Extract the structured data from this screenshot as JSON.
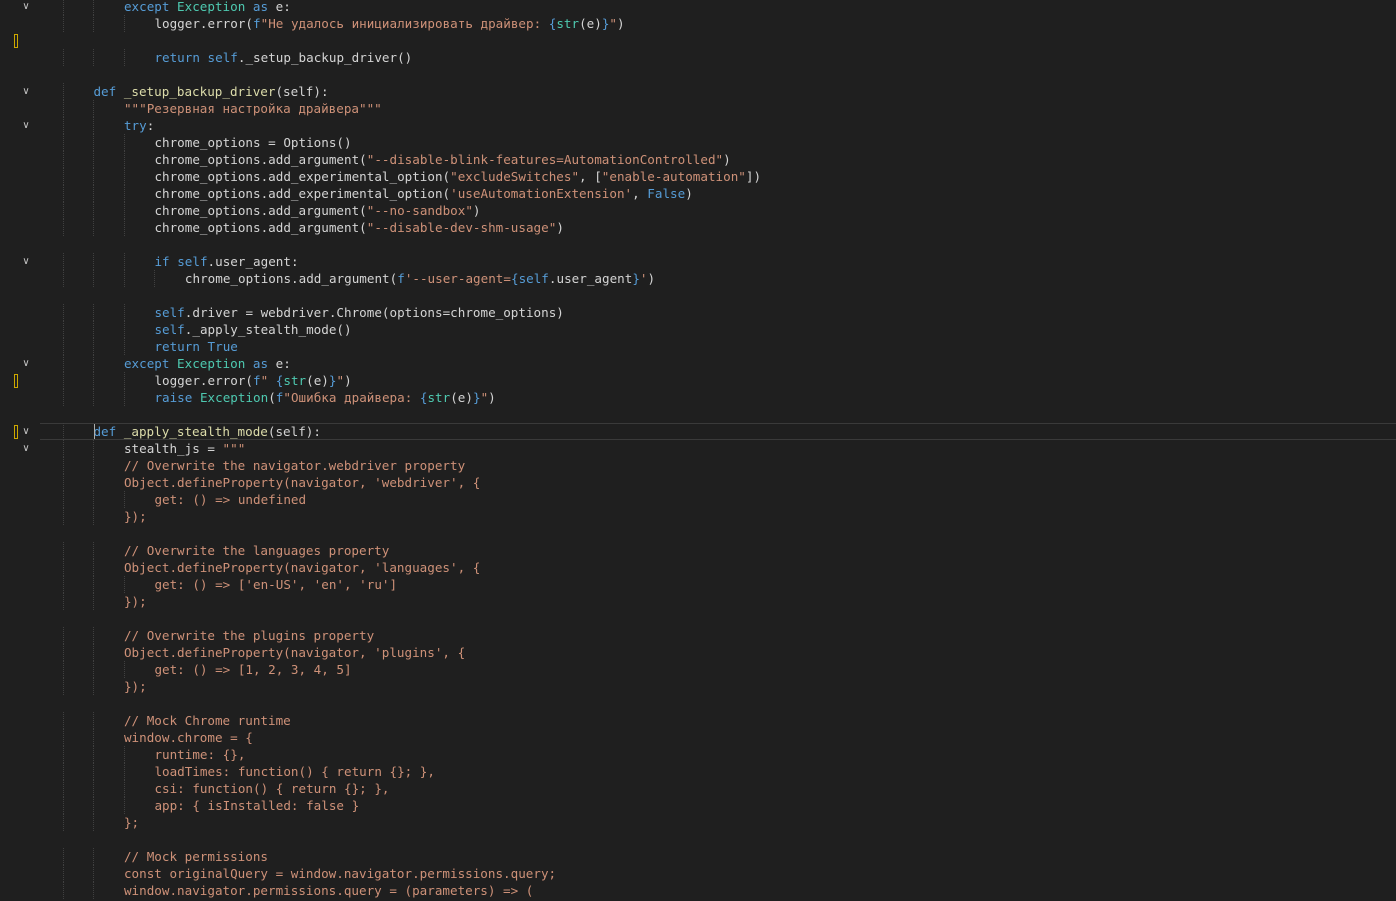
{
  "editor": {
    "language": "python",
    "colors": {
      "background": "#1f1f1f",
      "keyword": "#569cd6",
      "string": "#ce9178",
      "function": "#dcdcaa",
      "class": "#4ec9b0",
      "text": "#d4d4d4"
    },
    "lines": [
      [
        {
          "t": "except",
          "c": "kw"
        },
        {
          "t": " "
        },
        {
          "t": "Exception",
          "c": "cls"
        },
        {
          "t": " "
        },
        {
          "t": "as",
          "c": "kw"
        },
        {
          "t": " e:"
        }
      ],
      [
        {
          "t": "logger.error("
        },
        {
          "t": "f",
          "c": "kw"
        },
        {
          "t": "\"Не удалось инициализировать драйвер: ",
          "c": "str"
        },
        {
          "t": "{",
          "c": "kw"
        },
        {
          "t": "str",
          "c": "bi"
        },
        {
          "t": "(e)"
        },
        {
          "t": "}",
          "c": "kw"
        },
        {
          "t": "\"",
          "c": "str"
        },
        {
          "t": ")"
        }
      ],
      [],
      [
        {
          "t": "return",
          "c": "kw"
        },
        {
          "t": " "
        },
        {
          "t": "self",
          "c": "self"
        },
        {
          "t": "._setup_backup_driver()"
        }
      ],
      [],
      [
        {
          "t": "def",
          "c": "kw"
        },
        {
          "t": " "
        },
        {
          "t": "_setup_backup_driver",
          "c": "fn"
        },
        {
          "t": "(self):"
        }
      ],
      [
        {
          "t": "\"\"\"Резервная настройка драйвера\"\"\"",
          "c": "str"
        }
      ],
      [
        {
          "t": "try",
          "c": "kw"
        },
        {
          "t": ":"
        }
      ],
      [
        {
          "t": "chrome_options = Options()"
        }
      ],
      [
        {
          "t": "chrome_options.add_argument("
        },
        {
          "t": "\"--disable-blink-features=AutomationControlled\"",
          "c": "str"
        },
        {
          "t": ")"
        }
      ],
      [
        {
          "t": "chrome_options.add_experimental_option("
        },
        {
          "t": "\"excludeSwitches\"",
          "c": "str"
        },
        {
          "t": ", ["
        },
        {
          "t": "\"enable-automation\"",
          "c": "str"
        },
        {
          "t": "])"
        }
      ],
      [
        {
          "t": "chrome_options.add_experimental_option("
        },
        {
          "t": "'useAutomationExtension'",
          "c": "str"
        },
        {
          "t": ", "
        },
        {
          "t": "False",
          "c": "kw"
        },
        {
          "t": ")"
        }
      ],
      [
        {
          "t": "chrome_options.add_argument("
        },
        {
          "t": "\"--no-sandbox\"",
          "c": "str"
        },
        {
          "t": ")"
        }
      ],
      [
        {
          "t": "chrome_options.add_argument("
        },
        {
          "t": "\"--disable-dev-shm-usage\"",
          "c": "str"
        },
        {
          "t": ")"
        }
      ],
      [],
      [
        {
          "t": "if",
          "c": "kw"
        },
        {
          "t": " "
        },
        {
          "t": "self",
          "c": "self"
        },
        {
          "t": ".user_agent:"
        }
      ],
      [
        {
          "t": "chrome_options.add_argument("
        },
        {
          "t": "f",
          "c": "kw"
        },
        {
          "t": "'--user-agent=",
          "c": "str"
        },
        {
          "t": "{",
          "c": "kw"
        },
        {
          "t": "self",
          "c": "self"
        },
        {
          "t": ".user_agent"
        },
        {
          "t": "}",
          "c": "kw"
        },
        {
          "t": "'",
          "c": "str"
        },
        {
          "t": ")"
        }
      ],
      [],
      [
        {
          "t": "self",
          "c": "self"
        },
        {
          "t": ".driver = webdriver.Chrome(options=chrome_options)"
        }
      ],
      [
        {
          "t": "self",
          "c": "self"
        },
        {
          "t": "._apply_stealth_mode()"
        }
      ],
      [
        {
          "t": "return",
          "c": "kw"
        },
        {
          "t": " "
        },
        {
          "t": "True",
          "c": "kw"
        }
      ],
      [
        {
          "t": "except",
          "c": "kw"
        },
        {
          "t": " "
        },
        {
          "t": "Exception",
          "c": "cls"
        },
        {
          "t": " "
        },
        {
          "t": "as",
          "c": "kw"
        },
        {
          "t": " e:"
        }
      ],
      [
        {
          "t": "logger.error("
        },
        {
          "t": "f",
          "c": "kw"
        },
        {
          "t": "\" ",
          "c": "str"
        },
        {
          "t": "{",
          "c": "kw"
        },
        {
          "t": "str",
          "c": "bi"
        },
        {
          "t": "(e)"
        },
        {
          "t": "}",
          "c": "kw"
        },
        {
          "t": "\"",
          "c": "str"
        },
        {
          "t": ")"
        }
      ],
      [
        {
          "t": "raise",
          "c": "kw"
        },
        {
          "t": " "
        },
        {
          "t": "Exception",
          "c": "cls"
        },
        {
          "t": "("
        },
        {
          "t": "f",
          "c": "kw"
        },
        {
          "t": "\"Ошибка драйвера: ",
          "c": "str"
        },
        {
          "t": "{",
          "c": "kw"
        },
        {
          "t": "str",
          "c": "bi"
        },
        {
          "t": "(e)"
        },
        {
          "t": "}",
          "c": "kw"
        },
        {
          "t": "\"",
          "c": "str"
        },
        {
          "t": ")"
        }
      ],
      [],
      [
        {
          "t": "def",
          "c": "kw"
        },
        {
          "t": " "
        },
        {
          "t": "_apply_stealth_mode",
          "c": "fn"
        },
        {
          "t": "(self):"
        }
      ],
      [
        {
          "t": "stealth_js = "
        },
        {
          "t": "\"\"\"",
          "c": "str"
        }
      ],
      [
        {
          "t": "// Overwrite the navigator.webdriver property",
          "c": "jsc"
        }
      ],
      [
        {
          "t": "Object.defineProperty(navigator, 'webdriver', {",
          "c": "jsc"
        }
      ],
      [
        {
          "t": "get: () => undefined",
          "c": "jsc"
        }
      ],
      [
        {
          "t": "});",
          "c": "jsc"
        }
      ],
      [],
      [
        {
          "t": "// Overwrite the languages property",
          "c": "jsc"
        }
      ],
      [
        {
          "t": "Object.defineProperty(navigator, 'languages', {",
          "c": "jsc"
        }
      ],
      [
        {
          "t": "get: () => ['en-US', 'en', 'ru']",
          "c": "jsc"
        }
      ],
      [
        {
          "t": "});",
          "c": "jsc"
        }
      ],
      [],
      [
        {
          "t": "// Overwrite the plugins property",
          "c": "jsc"
        }
      ],
      [
        {
          "t": "Object.defineProperty(navigator, 'plugins', {",
          "c": "jsc"
        }
      ],
      [
        {
          "t": "get: () => [1, 2, 3, 4, 5]",
          "c": "jsc"
        }
      ],
      [
        {
          "t": "});",
          "c": "jsc"
        }
      ],
      [],
      [
        {
          "t": "// Mock Chrome runtime",
          "c": "jsc"
        }
      ],
      [
        {
          "t": "window.chrome = {",
          "c": "jsc"
        }
      ],
      [
        {
          "t": "runtime: {},",
          "c": "jsc"
        }
      ],
      [
        {
          "t": "loadTimes: function() { return {}; },",
          "c": "jsc"
        }
      ],
      [
        {
          "t": "csi: function() { return {}; },",
          "c": "jsc"
        }
      ],
      [
        {
          "t": "app: { isInstalled: false }",
          "c": "jsc"
        }
      ],
      [
        {
          "t": "};",
          "c": "jsc"
        }
      ],
      [],
      [
        {
          "t": "// Mock permissions",
          "c": "jsc"
        }
      ],
      [
        {
          "t": "const originalQuery = window.navigator.permissions.query;",
          "c": "jsc"
        }
      ],
      [
        {
          "t": "window.navigator.permissions.query = (parameters) => (",
          "c": "jsc"
        }
      ]
    ]
  }
}
